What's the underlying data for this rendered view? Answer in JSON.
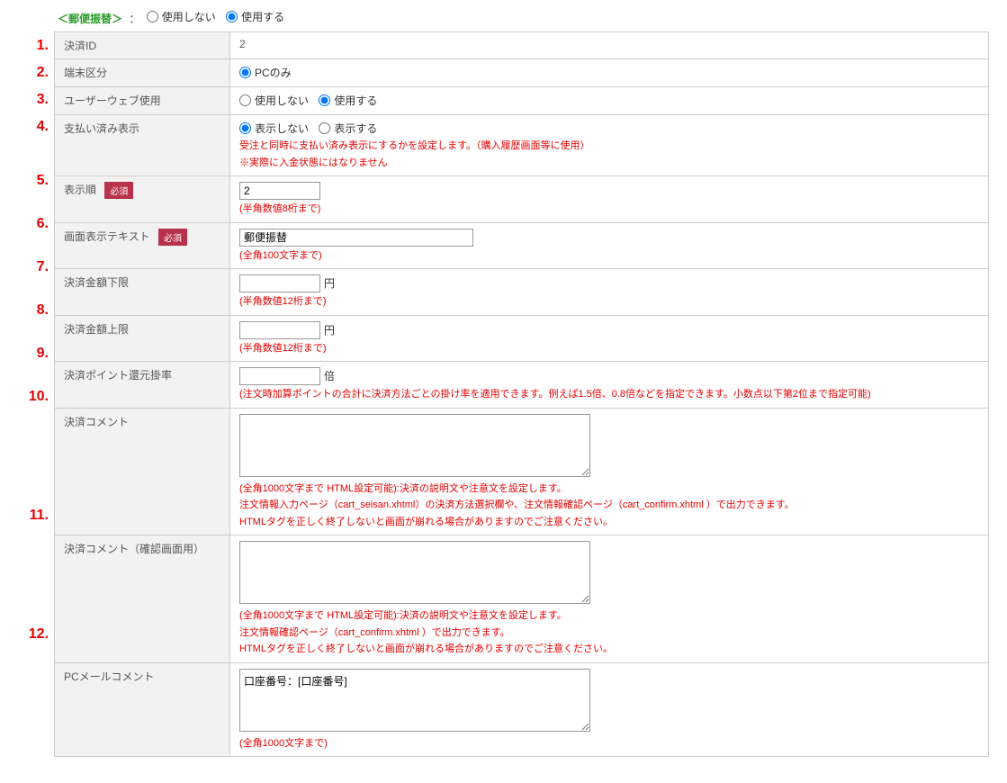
{
  "header": {
    "title": "＜郵便振替＞",
    "sep": "：",
    "opt_not_use": "使用しない",
    "opt_use": "使用する"
  },
  "numbers": [
    "1.",
    "2.",
    "3.",
    "4.",
    "5.",
    "6.",
    "7.",
    "8.",
    "9.",
    "10.",
    "11.",
    "12."
  ],
  "rows": {
    "r1": {
      "label": "決済ID",
      "value": "2"
    },
    "r2": {
      "label": "端末区分",
      "opt1": "PCのみ"
    },
    "r3": {
      "label": "ユーザーウェブ使用",
      "opt1": "使用しない",
      "opt2": "使用する"
    },
    "r4": {
      "label": "支払い済み表示",
      "opt1": "表示しない",
      "opt2": "表示する",
      "help1": "受注と同時に支払い済み表示にするかを設定します。（購入履歴画面等に使用）",
      "help2": "※実際に入金状態にはなりません"
    },
    "r5": {
      "label": "表示順",
      "req": "必須",
      "value": "2",
      "help": "(半角数値8桁まで)"
    },
    "r6": {
      "label": "画面表示テキスト",
      "req": "必須",
      "value": "郵便振替",
      "help": "(全角100文字まで)"
    },
    "r7": {
      "label": "決済金額下限",
      "unit": "円",
      "help": "(半角数値12桁まで)"
    },
    "r8": {
      "label": "決済金額上限",
      "unit": "円",
      "help": "(半角数値12桁まで)"
    },
    "r9": {
      "label": "決済ポイント還元掛率",
      "unit": "倍",
      "help": "(注文時加算ポイントの合計に決済方法ごとの掛け率を適用できます。例えば1.5倍、0.8倍などを指定できます。小数点以下第2位まで指定可能)"
    },
    "r10": {
      "label": "決済コメント",
      "help1": "(全角1000文字まで HTML設定可能):決済の説明文や注意文を設定します。",
      "help2": "注文情報入力ページ（cart_seisan.xhtml）の決済方法選択欄や、注文情報確認ページ（cart_confirm.xhtml ）で出力できます。",
      "help3": "HTMLタグを正しく終了しないと画面が崩れる場合がありますのでご注意ください。"
    },
    "r11": {
      "label": "決済コメント（確認画面用）",
      "help1": "(全角1000文字まで HTML設定可能):決済の説明文や注意文を設定します。",
      "help2": "注文情報確認ページ（cart_confirm.xhtml ）で出力できます。",
      "help3": "HTMLタグを正しく終了しないと画面が崩れる場合がありますのでご注意ください。"
    },
    "r12": {
      "label": "PCメールコメント",
      "value": "口座番号：[口座番号]",
      "help": "(全角1000文字まで)"
    }
  }
}
